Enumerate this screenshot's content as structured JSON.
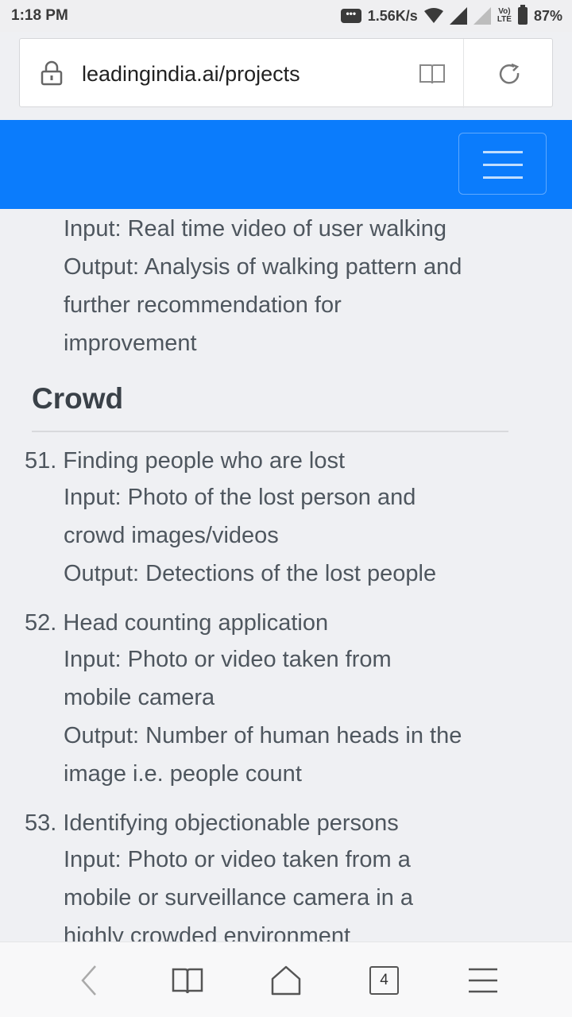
{
  "status": {
    "time": "1:18 PM",
    "speed": "1.56K/s",
    "lte": "Vo) LTE",
    "battery": "87%",
    "chat_dots": "•••"
  },
  "browser": {
    "url": "leadingindia.ai/projects",
    "tab_count": "4"
  },
  "content": {
    "prev_item": {
      "input": "Input: Real time video of user walking",
      "output_line1": "Output: Analysis of walking pattern and",
      "output_line2": "further recommendation for",
      "output_line3": "improvement"
    },
    "section_title": "Crowd",
    "items": [
      {
        "title": "51. Finding people who are lost",
        "lines": [
          "Input: Photo of the lost person and",
          "crowd images/videos",
          "Output: Detections of the lost people"
        ]
      },
      {
        "title": "52. Head counting application",
        "lines": [
          "Input: Photo or video taken from",
          "mobile camera",
          "Output: Number of human heads in the",
          "image i.e. people count"
        ]
      },
      {
        "title": "53. Identifying objectionable persons",
        "lines": [
          "Input: Photo or video taken from a",
          "mobile or surveillance camera in a",
          "highly crowded environment"
        ]
      }
    ]
  },
  "colors": {
    "navbar": "#0b7cfc",
    "background": "#eff0f3",
    "text": "#4e565e"
  }
}
